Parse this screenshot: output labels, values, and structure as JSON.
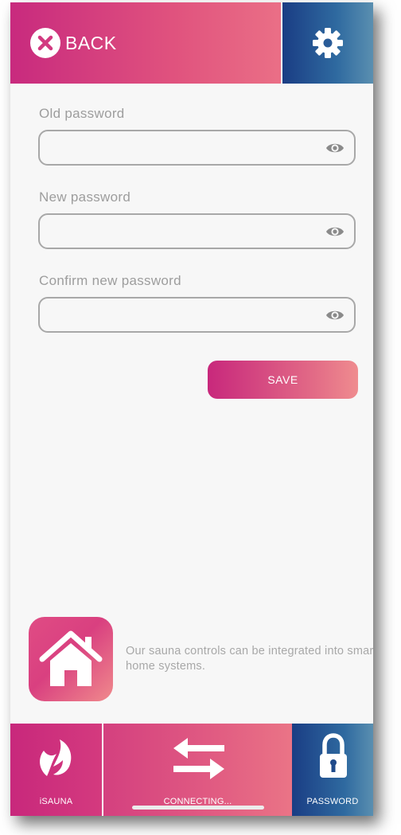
{
  "header": {
    "back_label": "BACK",
    "accent_color": "#c82a7e",
    "settings_color": "#1a3d84"
  },
  "form": {
    "old_password": {
      "label": "Old password",
      "value": "",
      "placeholder": ""
    },
    "new_password": {
      "label": "New password",
      "value": "",
      "placeholder": ""
    },
    "confirm_password": {
      "label": "Confirm new password",
      "value": "",
      "placeholder": ""
    },
    "save_label": "SAVE"
  },
  "promo": {
    "icon": "house-icon",
    "text": "Our sauna controls can be integrated into smart home systems."
  },
  "nav": {
    "items": [
      {
        "label": "iSAUNA",
        "icon": "isauna-logo-icon"
      },
      {
        "label": "CONNECTING...",
        "icon": "swap-arrows-icon"
      },
      {
        "label": "PASSWORD",
        "icon": "lock-icon"
      }
    ]
  }
}
